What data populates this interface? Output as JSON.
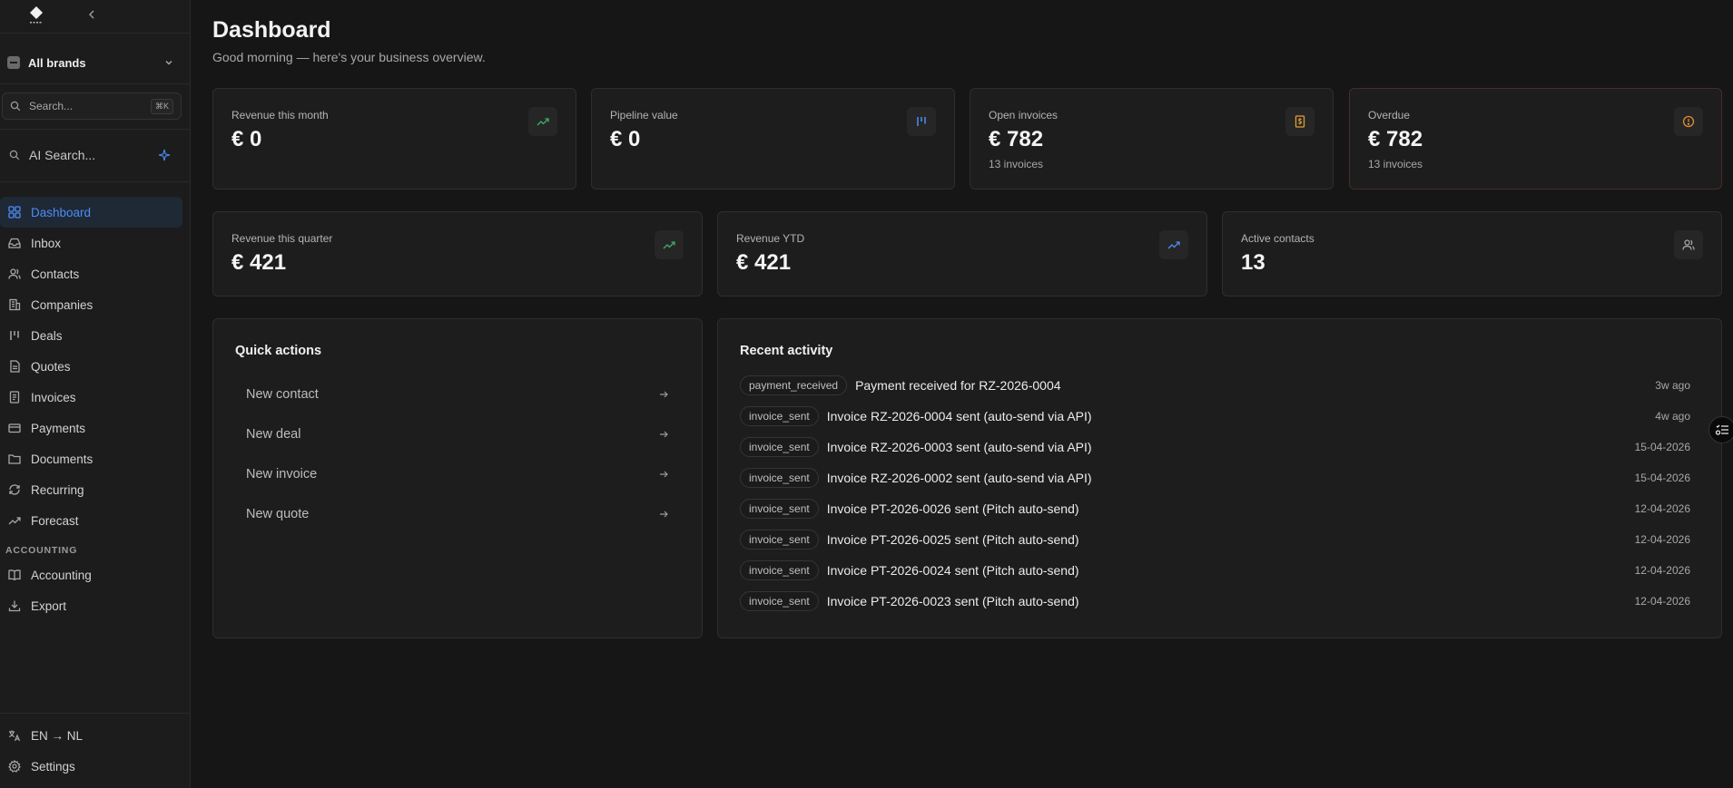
{
  "sidebar": {
    "brand_selector": "All brands",
    "search": {
      "placeholder": "Search...",
      "shortcut": "⌘K"
    },
    "ai_search": "AI Search...",
    "nav": [
      {
        "label": "Dashboard",
        "icon": "dashboard-icon",
        "active": true
      },
      {
        "label": "Inbox",
        "icon": "inbox-icon"
      },
      {
        "label": "Contacts",
        "icon": "contacts-icon"
      },
      {
        "label": "Companies",
        "icon": "building-icon"
      },
      {
        "label": "Deals",
        "icon": "kanban-icon"
      },
      {
        "label": "Quotes",
        "icon": "file-icon"
      },
      {
        "label": "Invoices",
        "icon": "receipt-icon"
      },
      {
        "label": "Payments",
        "icon": "credit-card-icon"
      },
      {
        "label": "Documents",
        "icon": "folder-icon"
      },
      {
        "label": "Recurring",
        "icon": "refresh-icon"
      },
      {
        "label": "Forecast",
        "icon": "trending-up-icon"
      }
    ],
    "section_accounting": "ACCOUNTING",
    "nav_accounting": [
      {
        "label": "Accounting",
        "icon": "book-icon"
      },
      {
        "label": "Export",
        "icon": "download-icon"
      }
    ],
    "language": "EN → NL",
    "settings": "Settings",
    "active_color": "#4c8df5"
  },
  "header": {
    "title": "Dashboard",
    "subtitle": "Good morning — here's your business overview."
  },
  "stats_row1": [
    {
      "label": "Revenue this month",
      "value": "€ 0",
      "sub": "",
      "icon": "trending-up-icon",
      "icon_color": "#3fae6a"
    },
    {
      "label": "Pipeline value",
      "value": "€ 0",
      "sub": "",
      "icon": "kanban-icon",
      "icon_color": "#4c8df5"
    },
    {
      "label": "Open invoices",
      "value": "€ 782",
      "sub": "13 invoices",
      "icon": "receipt-icon",
      "icon_color": "#e0a030"
    },
    {
      "label": "Overdue",
      "value": "€ 782",
      "sub": "13 invoices",
      "icon": "alert-circle-icon",
      "icon_color": "#e08a30"
    }
  ],
  "stats_row2": [
    {
      "label": "Revenue this quarter",
      "value": "€ 421",
      "icon": "trending-up-icon",
      "icon_color": "#3fae6a"
    },
    {
      "label": "Revenue YTD",
      "value": "€ 421",
      "icon": "trending-up-icon",
      "icon_color": "#4c8df5"
    },
    {
      "label": "Active contacts",
      "value": "13",
      "icon": "users-icon",
      "icon_color": "#a8a8a8"
    }
  ],
  "quick_actions": {
    "title": "Quick actions",
    "items": [
      "New contact",
      "New deal",
      "New invoice",
      "New quote"
    ]
  },
  "recent_activity": {
    "title": "Recent activity",
    "items": [
      {
        "type": "payment_received",
        "text": "Payment received for RZ-2026-0004",
        "time": "3w ago"
      },
      {
        "type": "invoice_sent",
        "text": "Invoice RZ-2026-0004 sent (auto-send via API)",
        "time": "4w ago"
      },
      {
        "type": "invoice_sent",
        "text": "Invoice RZ-2026-0003 sent (auto-send via API)",
        "time": "15-04-2026"
      },
      {
        "type": "invoice_sent",
        "text": "Invoice RZ-2026-0002 sent (auto-send via API)",
        "time": "15-04-2026"
      },
      {
        "type": "invoice_sent",
        "text": "Invoice PT-2026-0026 sent (Pitch auto-send)",
        "time": "12-04-2026"
      },
      {
        "type": "invoice_sent",
        "text": "Invoice PT-2026-0025 sent (Pitch auto-send)",
        "time": "12-04-2026"
      },
      {
        "type": "invoice_sent",
        "text": "Invoice PT-2026-0024 sent (Pitch auto-send)",
        "time": "12-04-2026"
      },
      {
        "type": "invoice_sent",
        "text": "Invoice PT-2026-0023 sent (Pitch auto-send)",
        "time": "12-04-2026"
      }
    ]
  }
}
